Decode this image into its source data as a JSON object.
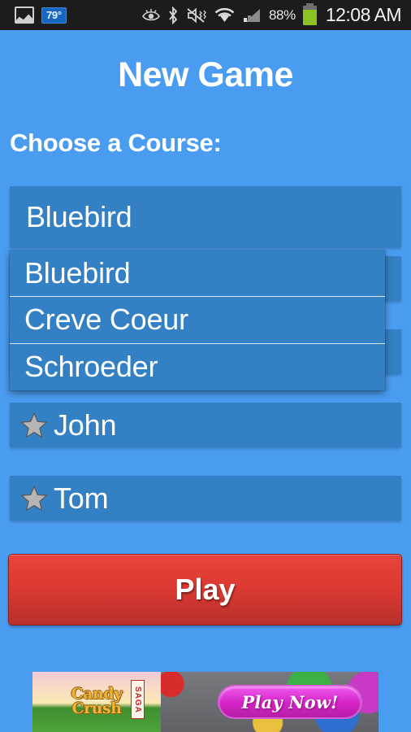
{
  "status_bar": {
    "gallery_icon": "gallery-icon",
    "weather_temp": "79°",
    "smart_stay_icon": "eye-icon",
    "bluetooth_icon": "bluetooth-icon",
    "mute_icon": "mute-vibrate-icon",
    "wifi_icon": "wifi-icon",
    "signal_icon": "cellular-signal-icon",
    "battery_percent": "88%",
    "battery_icon": "battery-icon",
    "time": "12:08 AM"
  },
  "screen": {
    "title": "New Game",
    "course_label": "Choose a Course:"
  },
  "course_spinner": {
    "selected": "Bluebird",
    "expanded": true,
    "options": [
      "Bluebird",
      "Creve Coeur",
      "Schroeder"
    ]
  },
  "players": [
    {
      "name": "John",
      "icon": "star-icon"
    },
    {
      "name": "Tom",
      "icon": "star-icon"
    }
  ],
  "play_button": {
    "label": "Play"
  },
  "ad_banner": {
    "brand_line1": "Candy",
    "brand_line2": "Crush",
    "badge": "SAGA",
    "cta": "Play Now!"
  },
  "colors": {
    "background": "#4a9cf0",
    "field": "#3381c4",
    "statusbar": "#1c1c1c",
    "play_button": "#dd3a33",
    "battery": "#8cc221",
    "ad_cta": "#d422c4"
  }
}
